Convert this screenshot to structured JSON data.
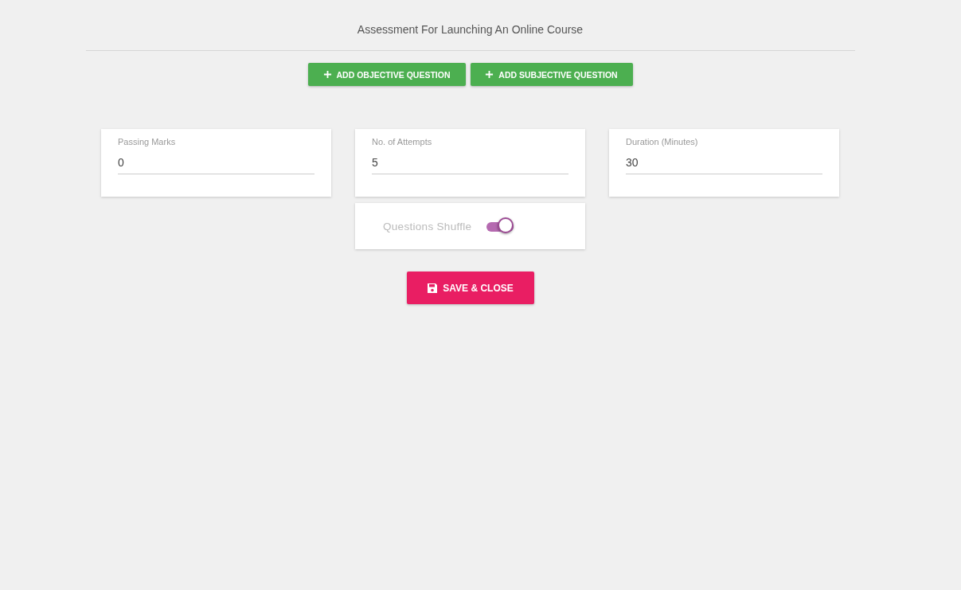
{
  "title": "Assessment For Launching An Online Course",
  "add_buttons": [
    {
      "label": "ADD OBJECTIVE QUESTION"
    },
    {
      "label": "ADD SUBJECTIVE QUESTION"
    }
  ],
  "fields": [
    {
      "label": "Passing Marks",
      "value": "0"
    },
    {
      "label": "No. of Attempts",
      "value": "5"
    },
    {
      "label": "Duration (Minutes)",
      "value": "30"
    }
  ],
  "shuffle": {
    "label": "Questions Shuffle",
    "on": true
  },
  "save_button": {
    "label": "SAVE & CLOSE"
  }
}
